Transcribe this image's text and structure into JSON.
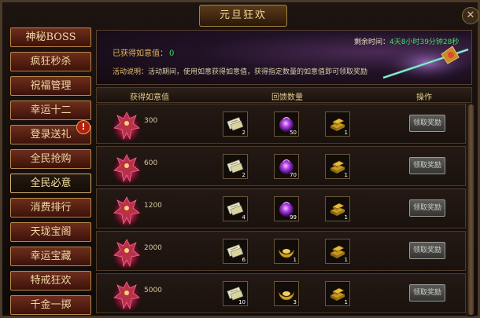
{
  "window": {
    "title": "元旦狂欢",
    "close_icon": "close-icon"
  },
  "sidebar": {
    "items": [
      {
        "label": "神秘BOSS"
      },
      {
        "label": "疯狂秒杀"
      },
      {
        "label": "祝福管理"
      },
      {
        "label": "幸运十二"
      },
      {
        "label": "登录送礼"
      },
      {
        "label": "全民抢购"
      },
      {
        "label": "全民必意",
        "active": true
      },
      {
        "label": "消费排行"
      },
      {
        "label": "天珑宝阁"
      },
      {
        "label": "幸运宝藏"
      },
      {
        "label": "特戒狂欢"
      },
      {
        "label": "千金一掷"
      }
    ],
    "badge": "!"
  },
  "banner": {
    "got_label": "已获得如意值：",
    "got_value": "0",
    "desc_label": "活动说明：",
    "desc_text": "活动期间，使用如意获得如意值，获得指定数量的如意值即可领取奖励",
    "timer_label": "剩余时间：",
    "timer_value": "4天8小时39分钟28秒"
  },
  "table": {
    "headers": {
      "value": "获得如意值",
      "rewards": "回馈数量",
      "action": "操作"
    },
    "claim_label": "领取奖励",
    "rows": [
      {
        "value": "300",
        "items": [
          {
            "icon": "scroll-icon",
            "count": "2"
          },
          {
            "icon": "purple-orb-icon",
            "count": "50"
          },
          {
            "icon": "gold-bars-icon",
            "count": "1"
          }
        ]
      },
      {
        "value": "600",
        "items": [
          {
            "icon": "scroll-icon",
            "count": "2"
          },
          {
            "icon": "purple-orb-icon",
            "count": "70"
          },
          {
            "icon": "gold-bars-icon",
            "count": "1"
          }
        ]
      },
      {
        "value": "1200",
        "items": [
          {
            "icon": "scroll-icon",
            "count": "4"
          },
          {
            "icon": "purple-orb-icon",
            "count": "99"
          },
          {
            "icon": "gold-bars-icon",
            "count": "1"
          }
        ]
      },
      {
        "value": "2000",
        "items": [
          {
            "icon": "scroll-icon",
            "count": "6"
          },
          {
            "icon": "gold-ingot-icon",
            "count": "1"
          },
          {
            "icon": "gold-bars-icon",
            "count": "1"
          }
        ]
      },
      {
        "value": "5000",
        "items": [
          {
            "icon": "scroll-icon",
            "count": "10"
          },
          {
            "icon": "gold-ingot-icon",
            "count": "3"
          },
          {
            "icon": "gold-bars-icon",
            "count": "1"
          }
        ]
      }
    ]
  }
}
